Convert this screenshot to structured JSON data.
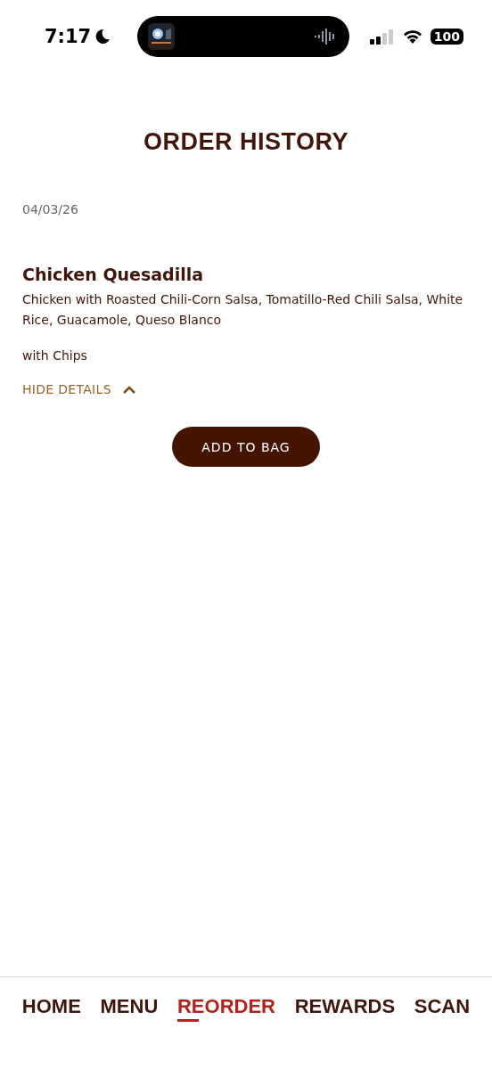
{
  "status_bar": {
    "time": "7:17",
    "battery": "100"
  },
  "title": "ORDER HISTORY",
  "orders": [
    {
      "date": "04/03/26",
      "item": "Chicken Quesadilla",
      "ingredients": "Chicken with Roasted Chili-Corn Salsa, Tomatillo-Red Chili Salsa, White Rice, Guacamole, Queso Blanco",
      "side": "with Chips",
      "toggle": "HIDE DETAILS",
      "expanded": true,
      "button": "ADD TO BAG"
    }
  ],
  "nav": [
    {
      "label": "HOME",
      "selected": false
    },
    {
      "label": "MENU",
      "selected": false
    },
    {
      "label": "REORDER",
      "selected": true
    },
    {
      "label": "REWARDS",
      "selected": false
    },
    {
      "label": "SCAN",
      "selected": false
    }
  ]
}
